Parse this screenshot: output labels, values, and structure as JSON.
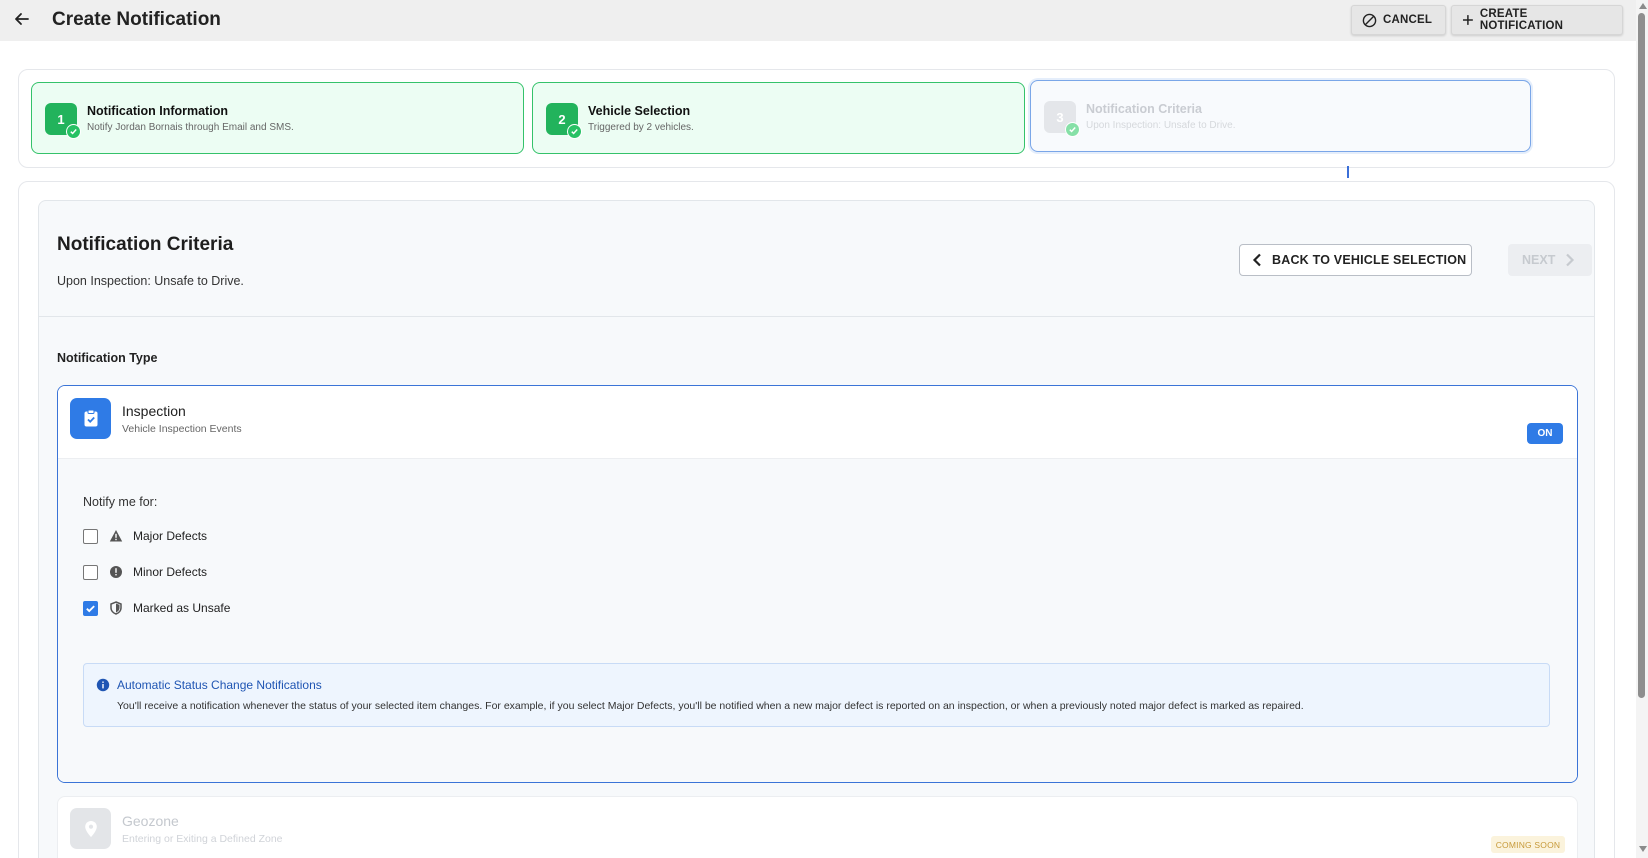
{
  "header": {
    "title": "Create Notification",
    "cancel_label": "CANCEL",
    "create_label": "CREATE NOTIFICATION"
  },
  "steps": [
    {
      "number": "1",
      "title": "Notification Information",
      "subtitle": "Notify Jordan Bornais through Email and SMS.",
      "status": "complete"
    },
    {
      "number": "2",
      "title": "Vehicle Selection",
      "subtitle": "Triggered by 2 vehicles.",
      "status": "complete"
    },
    {
      "number": "3",
      "title": "Notification Criteria",
      "subtitle": "Upon Inspection: Unsafe to Drive.",
      "status": "active"
    }
  ],
  "criteria": {
    "title": "Notification Criteria",
    "subtitle": "Upon Inspection: Unsafe to Drive.",
    "back_label": "BACK TO VEHICLE SELECTION",
    "next_label": "NEXT",
    "type_label": "Notification Type"
  },
  "inspection": {
    "title": "Inspection",
    "subtitle": "Vehicle Inspection Events",
    "status": "ON",
    "notify_label": "Notify me for:",
    "options": [
      {
        "label": "Major Defects",
        "checked": false,
        "icon": "warning-triangle-icon"
      },
      {
        "label": "Minor Defects",
        "checked": false,
        "icon": "exclamation-circle-icon"
      },
      {
        "label": "Marked as Unsafe",
        "checked": true,
        "icon": "shield-icon"
      }
    ],
    "info_title": "Automatic Status Change Notifications",
    "info_text": "You'll receive a notification whenever the status of your selected item changes. For example, if you select Major Defects, you'll be notified when a new major defect is reported on an inspection, or when a previously noted major defect is marked as repaired."
  },
  "geozone": {
    "title": "Geozone",
    "subtitle": "Entering or Exiting a Defined Zone",
    "badge": "COMING SOON"
  },
  "colors": {
    "accent": "#2f7be6",
    "success": "#22b35c",
    "success_bg": "#ecfdf3",
    "info_bg": "#eef5fe",
    "soon_bg": "#fbf3dc"
  }
}
